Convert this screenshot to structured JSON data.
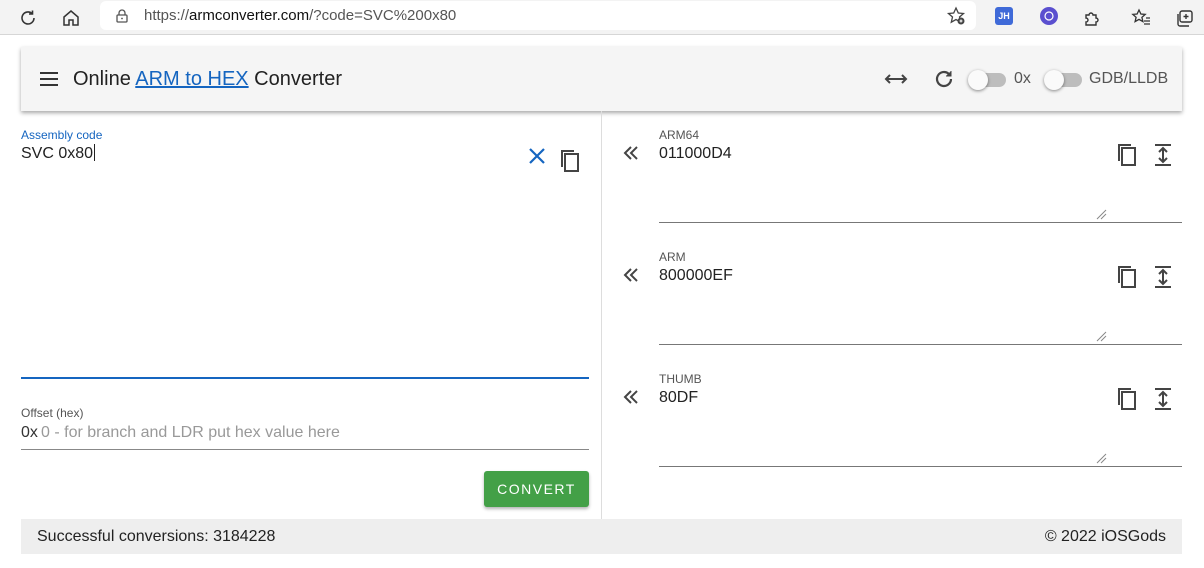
{
  "browser": {
    "url_prefix": "https://",
    "url_domain": "armconverter.com",
    "url_path": "/?code=SVC%200x80",
    "icons": [
      "reload-icon",
      "home-icon",
      "lock-icon",
      "favorite-add-icon",
      "extension-jh-icon",
      "extension-vpn-icon",
      "puzzle-icon",
      "favorites-icon",
      "collections-icon"
    ],
    "ext_jh_label": "JH"
  },
  "header": {
    "title_prefix": "Online ",
    "title_link": "ARM to HEX",
    "title_suffix": " Converter",
    "toggle_hex_label": "0x",
    "toggle_gdb_label": "GDB/LLDB",
    "toggle_hex_on": false,
    "toggle_gdb_on": false
  },
  "assembly": {
    "label": "Assembly code",
    "value": "SVC 0x80"
  },
  "offset": {
    "label": "Offset (hex)",
    "prefix": "0x",
    "placeholder": "0 - for branch and LDR put hex value here"
  },
  "convert_label": "CONVERT",
  "outputs": [
    {
      "label": "ARM64",
      "value": "011000D4"
    },
    {
      "label": "ARM",
      "value": "800000EF"
    },
    {
      "label": "THUMB",
      "value": "80DF"
    }
  ],
  "footer": {
    "conversions": "Successful conversions: 3184228",
    "copyright": "© 2022 iOSGods"
  },
  "colors": {
    "accent": "#1565c0",
    "convert_button": "#43a047"
  }
}
